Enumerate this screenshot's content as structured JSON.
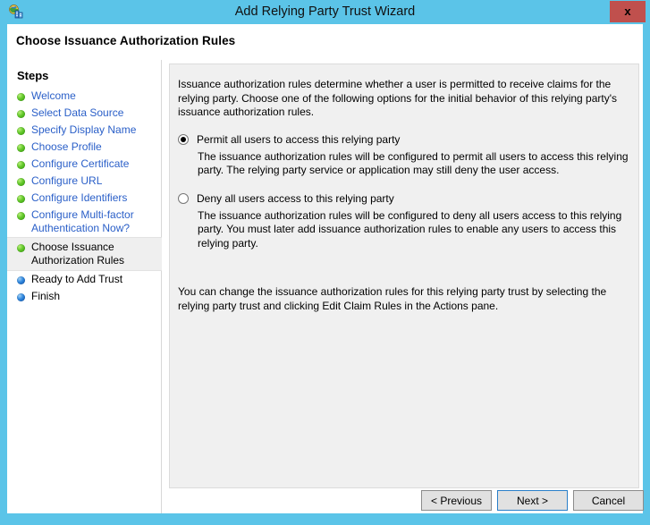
{
  "window": {
    "title": "Add Relying Party Trust Wizard",
    "icon": "relying-party-trust-icon",
    "close_label": "x",
    "frame_color": "#5bc4e8",
    "close_color": "#c0504d"
  },
  "header": {
    "title": "Choose Issuance Authorization Rules"
  },
  "sidebar": {
    "heading": "Steps",
    "items": [
      {
        "label": "Welcome",
        "state": "done",
        "bullet": "green"
      },
      {
        "label": "Select Data Source",
        "state": "done",
        "bullet": "green"
      },
      {
        "label": "Specify Display Name",
        "state": "done",
        "bullet": "green"
      },
      {
        "label": "Choose Profile",
        "state": "done",
        "bullet": "green"
      },
      {
        "label": "Configure Certificate",
        "state": "done",
        "bullet": "green"
      },
      {
        "label": "Configure URL",
        "state": "done",
        "bullet": "green"
      },
      {
        "label": "Configure Identifiers",
        "state": "done",
        "bullet": "green"
      },
      {
        "label": "Configure Multi-factor\nAuthentication Now?",
        "state": "done",
        "bullet": "green"
      },
      {
        "label": "Choose Issuance\nAuthorization Rules",
        "state": "current",
        "bullet": "green"
      },
      {
        "label": "Ready to Add Trust",
        "state": "pending",
        "bullet": "blue"
      },
      {
        "label": "Finish",
        "state": "pending",
        "bullet": "blue"
      }
    ]
  },
  "content": {
    "intro": "Issuance authorization rules determine whether a user is permitted to receive claims for the relying party. Choose one of the following options for the initial behavior of this relying party's issuance authorization rules.",
    "options": [
      {
        "label": "Permit all users to access this relying party",
        "selected": true,
        "description": "The issuance authorization rules will be configured to permit all users to access this relying party. The relying party service or application may still deny the user access."
      },
      {
        "label": "Deny all users access to this relying party",
        "selected": false,
        "description": "The issuance authorization rules will be configured to deny all users access to this relying party. You must later add issuance authorization rules to enable any users to access this relying party."
      }
    ],
    "footnote": "You can change the issuance authorization rules for this relying party trust by selecting the relying party trust and clicking Edit Claim Rules in the Actions pane."
  },
  "buttons": {
    "previous": "< Previous",
    "next": "Next >",
    "cancel": "Cancel",
    "focused": "next"
  }
}
